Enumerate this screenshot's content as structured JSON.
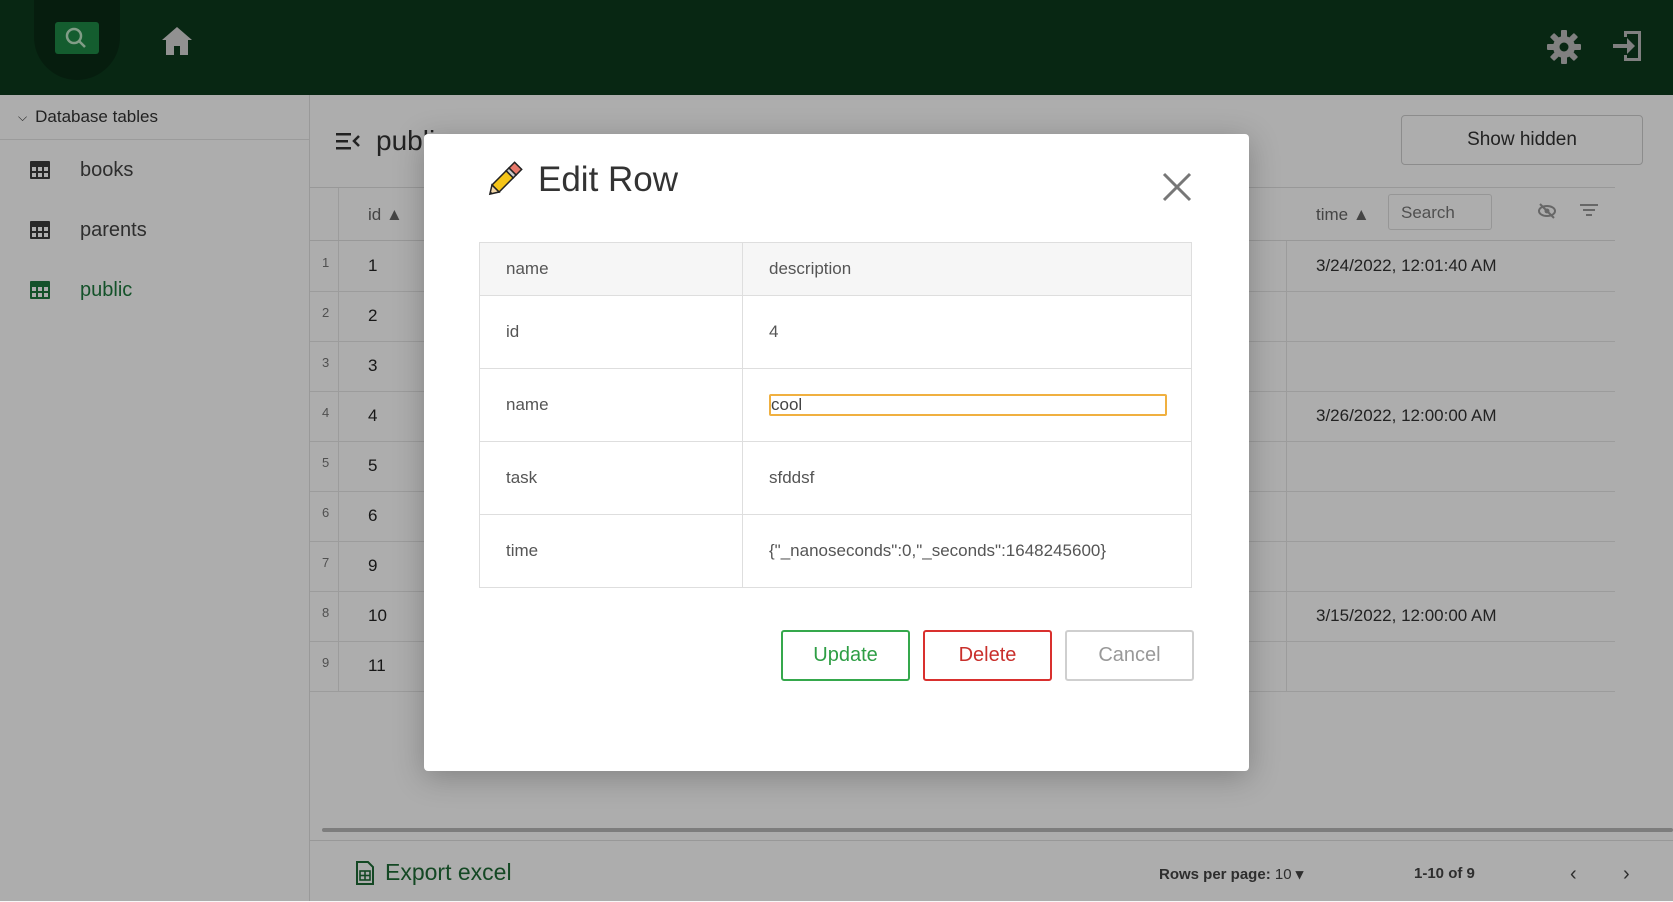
{
  "header": {
    "logo": "search-logo-icon",
    "home": "home-icon",
    "settings": "gear-icon",
    "logout": "logout-icon"
  },
  "sidebar": {
    "heading": "Database tables",
    "items": [
      {
        "label": "books",
        "active": false
      },
      {
        "label": "parents",
        "active": false
      },
      {
        "label": "public",
        "active": true
      }
    ]
  },
  "main": {
    "title": "public",
    "show_hidden_label": "Show hidden",
    "columns": {
      "id": "id",
      "time": "time",
      "search_placeholder": "Search"
    },
    "rows": [
      {
        "n": "1",
        "id": "1",
        "time": "3/24/2022, 12:01:40 AM"
      },
      {
        "n": "2",
        "id": "2",
        "time": ""
      },
      {
        "n": "3",
        "id": "3",
        "time": ""
      },
      {
        "n": "4",
        "id": "4",
        "time": "3/26/2022, 12:00:00 AM"
      },
      {
        "n": "5",
        "id": "5",
        "time": ""
      },
      {
        "n": "6",
        "id": "6",
        "time": ""
      },
      {
        "n": "7",
        "id": "9",
        "time": ""
      },
      {
        "n": "8",
        "id": "10",
        "time": "3/15/2022, 12:00:00 AM"
      },
      {
        "n": "9",
        "id": "11",
        "time": ""
      }
    ],
    "footer": {
      "export_label": "Export excel",
      "rows_per_page_label": "Rows per page:",
      "rows_per_page_value": "10",
      "page_info": "1-10 of 9"
    }
  },
  "modal": {
    "title": "Edit Row",
    "header_name": "name",
    "header_description": "description",
    "fields": [
      {
        "name": "id",
        "value": "4"
      },
      {
        "name": "name",
        "value": "cool"
      },
      {
        "name": "task",
        "value": "sfddsf"
      },
      {
        "name": "time",
        "value": "{\"_nanoseconds\":0,\"_seconds\":1648245600}"
      }
    ],
    "update_label": "Update",
    "delete_label": "Delete",
    "cancel_label": "Cancel",
    "colors": {
      "update": "#35a84c",
      "delete": "#d9302e",
      "focus": "#f0b040",
      "brand": "#0c3a1c"
    }
  }
}
